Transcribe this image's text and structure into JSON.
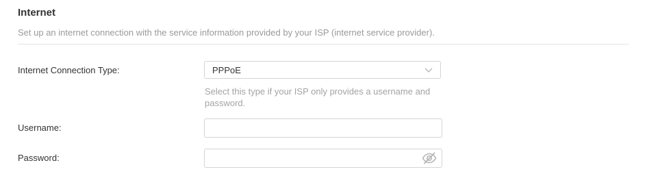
{
  "section": {
    "title": "Internet",
    "description": "Set up an internet connection with the service information provided by your ISP (internet service provider)."
  },
  "connection_type": {
    "label": "Internet Connection Type:",
    "selected": "PPPoE",
    "hint": "Select this type if your ISP only provides a username and password."
  },
  "username": {
    "label": "Username:",
    "value": ""
  },
  "password": {
    "label": "Password:",
    "value": ""
  },
  "icons": {
    "dropdown": "chevron-down-icon",
    "password_visibility": "eye-slash-icon"
  },
  "colors": {
    "label_text": "#333333",
    "muted_text": "#9a9a9a",
    "border": "#d4d4d4",
    "icon": "#b5b5b5"
  }
}
